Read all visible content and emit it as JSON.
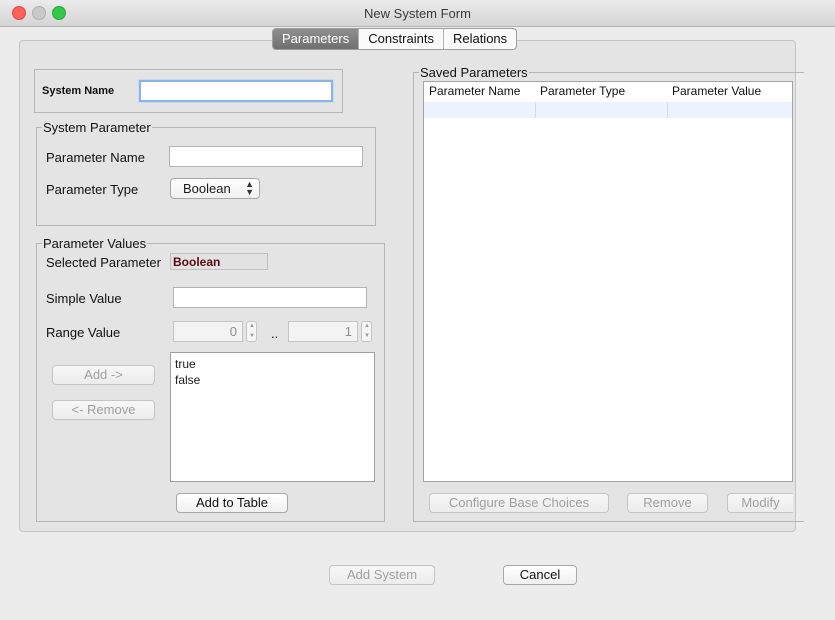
{
  "window": {
    "title": "New System Form"
  },
  "tabs": [
    {
      "label": "Parameters",
      "active": true
    },
    {
      "label": "Constraints",
      "active": false
    },
    {
      "label": "Relations",
      "active": false
    }
  ],
  "system_name": {
    "label": "System Name",
    "value": ""
  },
  "system_parameter": {
    "legend": "System Parameter",
    "name_label": "Parameter Name",
    "name_value": "",
    "type_label": "Parameter Type",
    "type_value": "Boolean"
  },
  "parameter_values": {
    "legend": "Parameter Values",
    "selected_label": "Selected Parameter",
    "selected_value": "Boolean",
    "simple_label": "Simple Value",
    "simple_value": "",
    "range_label": "Range Value",
    "range_from": "0",
    "range_sep": "..",
    "range_to": "1",
    "add_button": "Add ->",
    "remove_button": "<- Remove",
    "values": [
      "true",
      "false"
    ],
    "add_to_table_button": "Add to Table"
  },
  "saved_parameters": {
    "legend": "Saved Parameters",
    "columns": [
      "Parameter Name",
      "Parameter Type",
      "Parameter Value"
    ],
    "configure_button": "Configure Base Choices",
    "remove_button": "Remove",
    "modify_button": "Modify"
  },
  "footer": {
    "add_system_button": "Add System",
    "cancel_button": "Cancel"
  },
  "colors": {
    "selected_value_text": "#5a0b12",
    "active_tab": "#7a7a7a",
    "focus_ring": "#8ab4e8"
  }
}
